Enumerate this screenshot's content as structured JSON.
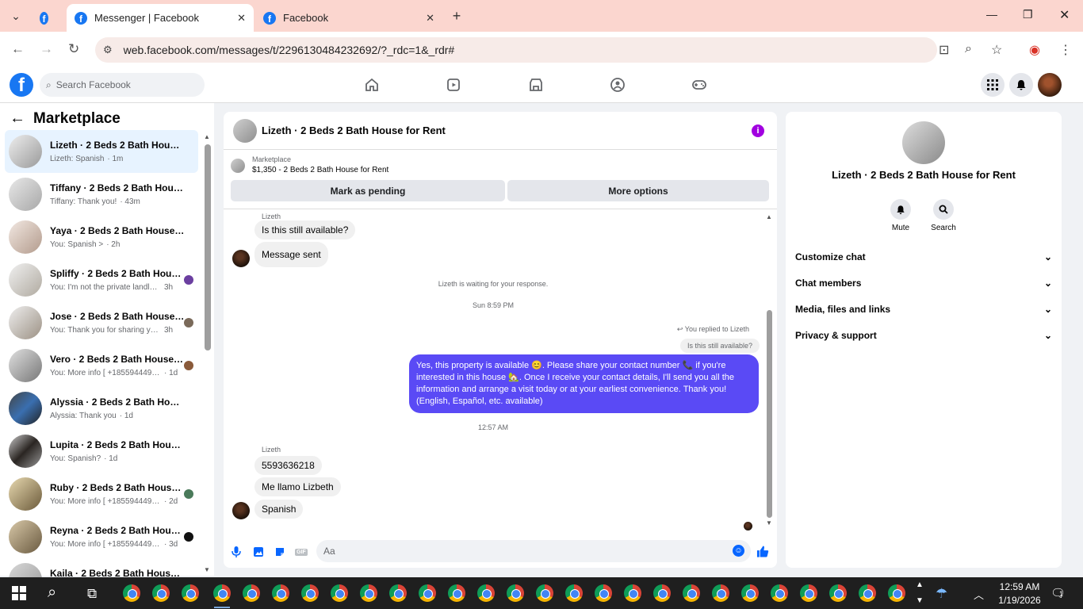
{
  "browser": {
    "tabs": [
      {
        "title": ""
      },
      {
        "title": "Messenger | Facebook"
      },
      {
        "title": "Facebook"
      }
    ],
    "url": "web.facebook.com/messages/t/2296130484232692/?_rdc=1&_rdr#"
  },
  "fb": {
    "search_placeholder": "Search Facebook"
  },
  "sidebar": {
    "title": "Marketplace",
    "conversations": [
      {
        "name": "Lizeth · 2 Beds 2 Bath House for Rent",
        "preview": "Lizeth: Spanish",
        "time": "· 1m"
      },
      {
        "name": "Tiffany · 2 Beds 2 Bath House for Rent",
        "preview": "Tiffany: Thank you!",
        "time": "· 43m"
      },
      {
        "name": "Yaya · 2 Beds 2 Bath House for Rent",
        "preview": "You: Spanish >",
        "time": "· 2h"
      },
      {
        "name": "Spliffy · 2 Beds 2 Bath House for Rent",
        "preview": "You: I'm not the private landlord...",
        "time": "3h"
      },
      {
        "name": "Jose · 2 Beds 2 Bath House for Rent",
        "preview": "You: Thank you for sharing your...",
        "time": "3h"
      },
      {
        "name": "Vero · 2 Beds 2 Bath House for Rent",
        "preview": "You: More info [ +18559444913...",
        "time": "· 1d"
      },
      {
        "name": "Alyssia · 2 Beds 2 Bath House for Rent",
        "preview": "Alyssia: Thank you",
        "time": "· 1d"
      },
      {
        "name": "Lupita · 2 Beds 2 Bath House for Rent",
        "preview": "You: Spanish?",
        "time": "· 1d"
      },
      {
        "name": "Ruby · 2 Beds 2 Bath House for Rent",
        "preview": "You: More info [ +18559444913...",
        "time": "· 2d"
      },
      {
        "name": "Reyna · 2 Beds 2 Bath House for Rent",
        "preview": "You: More info [ +18559444913...",
        "time": "· 3d"
      },
      {
        "name": "Kaila · 2 Beds 2 Bath House for Rent",
        "preview": "",
        "time": ""
      }
    ]
  },
  "chat": {
    "title": "Lizeth · 2 Beds 2 Bath House for Rent",
    "marketplace_label": "Marketplace",
    "listing": "$1,350 - 2 Beds 2 Bath House for Rent",
    "mark_pending": "Mark as pending",
    "more_options": "More options",
    "sender1": "Lizeth",
    "msg1": "Is this still available?",
    "msg2": "Message sent",
    "waiting": "Lizeth is waiting for your response.",
    "ts1": "Sun 8:59 PM",
    "replied": "You replied to Lizeth",
    "quoted": "Is this still available?",
    "reply_text": "Yes, this property is available 😊. Please share your contact number 📞 if you're interested in this house 🏡. Once I receive your contact details, I'll send you all the information and arrange a visit today or at your earliest convenience. Thank you! (English, Español, etc. available)",
    "ts2": "12:57 AM",
    "sender2": "Lizeth",
    "msg3": "5593636218",
    "msg4": "Me llamo Lizbeth",
    "msg5": "Spanish",
    "input_placeholder": "Aa"
  },
  "details": {
    "name": "Lizeth · 2 Beds 2 Bath House for Rent",
    "mute": "Mute",
    "search": "Search",
    "sections": [
      "Customize chat",
      "Chat members",
      "Media, files and links",
      "Privacy & support"
    ]
  },
  "taskbar": {
    "time": "12:59 AM",
    "date": "1/19/2026",
    "notif": "1"
  }
}
